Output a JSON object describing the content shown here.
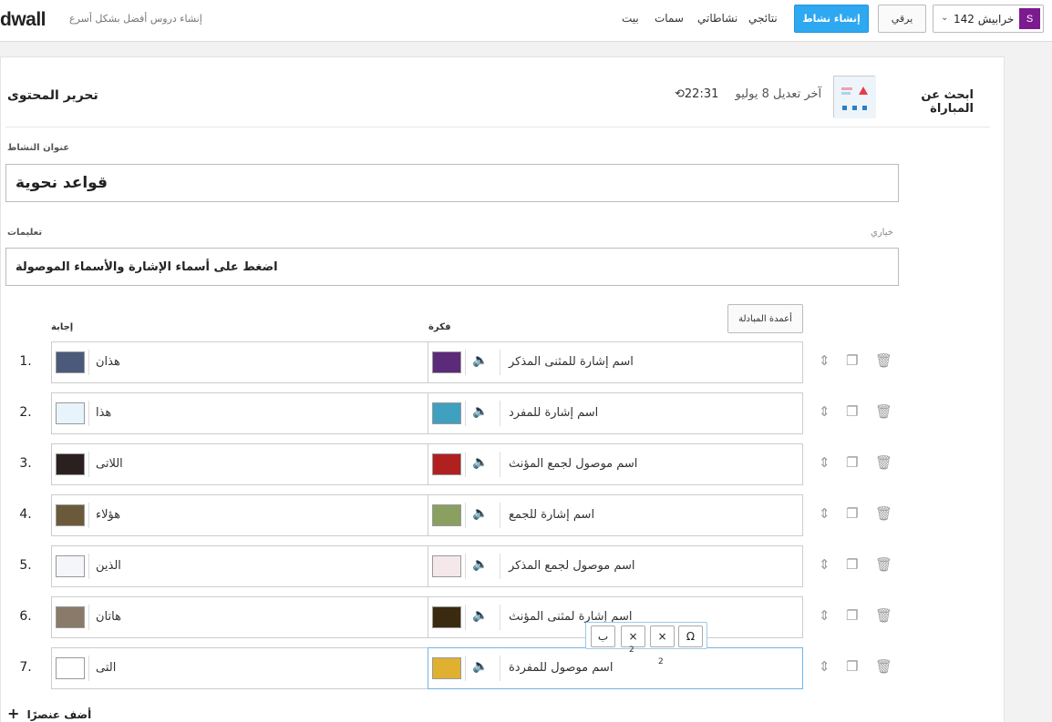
{
  "brand": {
    "logo": "dwall",
    "tagline": "إنشاء دروس أفضل بشكل أسرع"
  },
  "nav": {
    "home": "بيت",
    "features": "سمات",
    "activities": "نشاطاتي",
    "results": "نتائجي"
  },
  "actions": {
    "create": "إنشاء نشاط",
    "upgrade": "يرقي"
  },
  "user": {
    "name": "خرابيش 142",
    "initial": "S"
  },
  "editor": {
    "title": "تحرير المحتوى",
    "last_edit_label": "آخر تعديل 8 يوليو",
    "last_edit_time": "22:31",
    "template_name": "ابحث عن المباراة",
    "activity_title_label": "عنوان النشاط",
    "activity_title": "قواعد نحوية",
    "instructions_label": "تعليمات",
    "instructions_optional": "خياري",
    "instructions": "اضغط على أسماء الإشارة والأسماء الموصولة",
    "swap_button": "أعمدة المبادلة",
    "col_answer": "إجابة",
    "col_idea": "فكرة",
    "add_item": "أضف عنصرًا"
  },
  "rows": [
    {
      "num": "1.",
      "answer": "هذان",
      "idea": "اسم إشارة للمثنى المذكر",
      "ans_color": "#4b5a7a",
      "idea_color": "#5b2a78"
    },
    {
      "num": "2.",
      "answer": "هذا",
      "idea": "اسم إشارة للمفرد",
      "ans_color": "#e8f4fb",
      "idea_color": "#3fa0c0"
    },
    {
      "num": "3.",
      "answer": "اللاتى",
      "idea": "اسم موصول لجمع المؤنث",
      "ans_color": "#2b2020",
      "idea_color": "#b02020"
    },
    {
      "num": "4.",
      "answer": "هؤلاء",
      "idea": "اسم إشارة للجمع",
      "ans_color": "#6b5a3a",
      "idea_color": "#8aa060"
    },
    {
      "num": "5.",
      "answer": "الذين",
      "idea": "اسم موصول لجمع المذكر",
      "ans_color": "#f4f6fa",
      "idea_color": "#f5e8ea"
    },
    {
      "num": "6.",
      "answer": "هاتان",
      "idea": "اسم إشارة لمثنى المؤنث",
      "ans_color": "#8a7a6a",
      "idea_color": "#3a2a10"
    },
    {
      "num": "7.",
      "answer": "التى",
      "idea": "اسم موصول للمفردة",
      "ans_color": "#ffffff",
      "idea_color": "#e0b030"
    }
  ],
  "toolbar": {
    "omega": "Ω",
    "times1": "×",
    "times2": "×",
    "baa": "ب",
    "sub": "2"
  },
  "colors": {
    "accent": "#2ea8f0",
    "avatar": "#7c1a8f"
  }
}
